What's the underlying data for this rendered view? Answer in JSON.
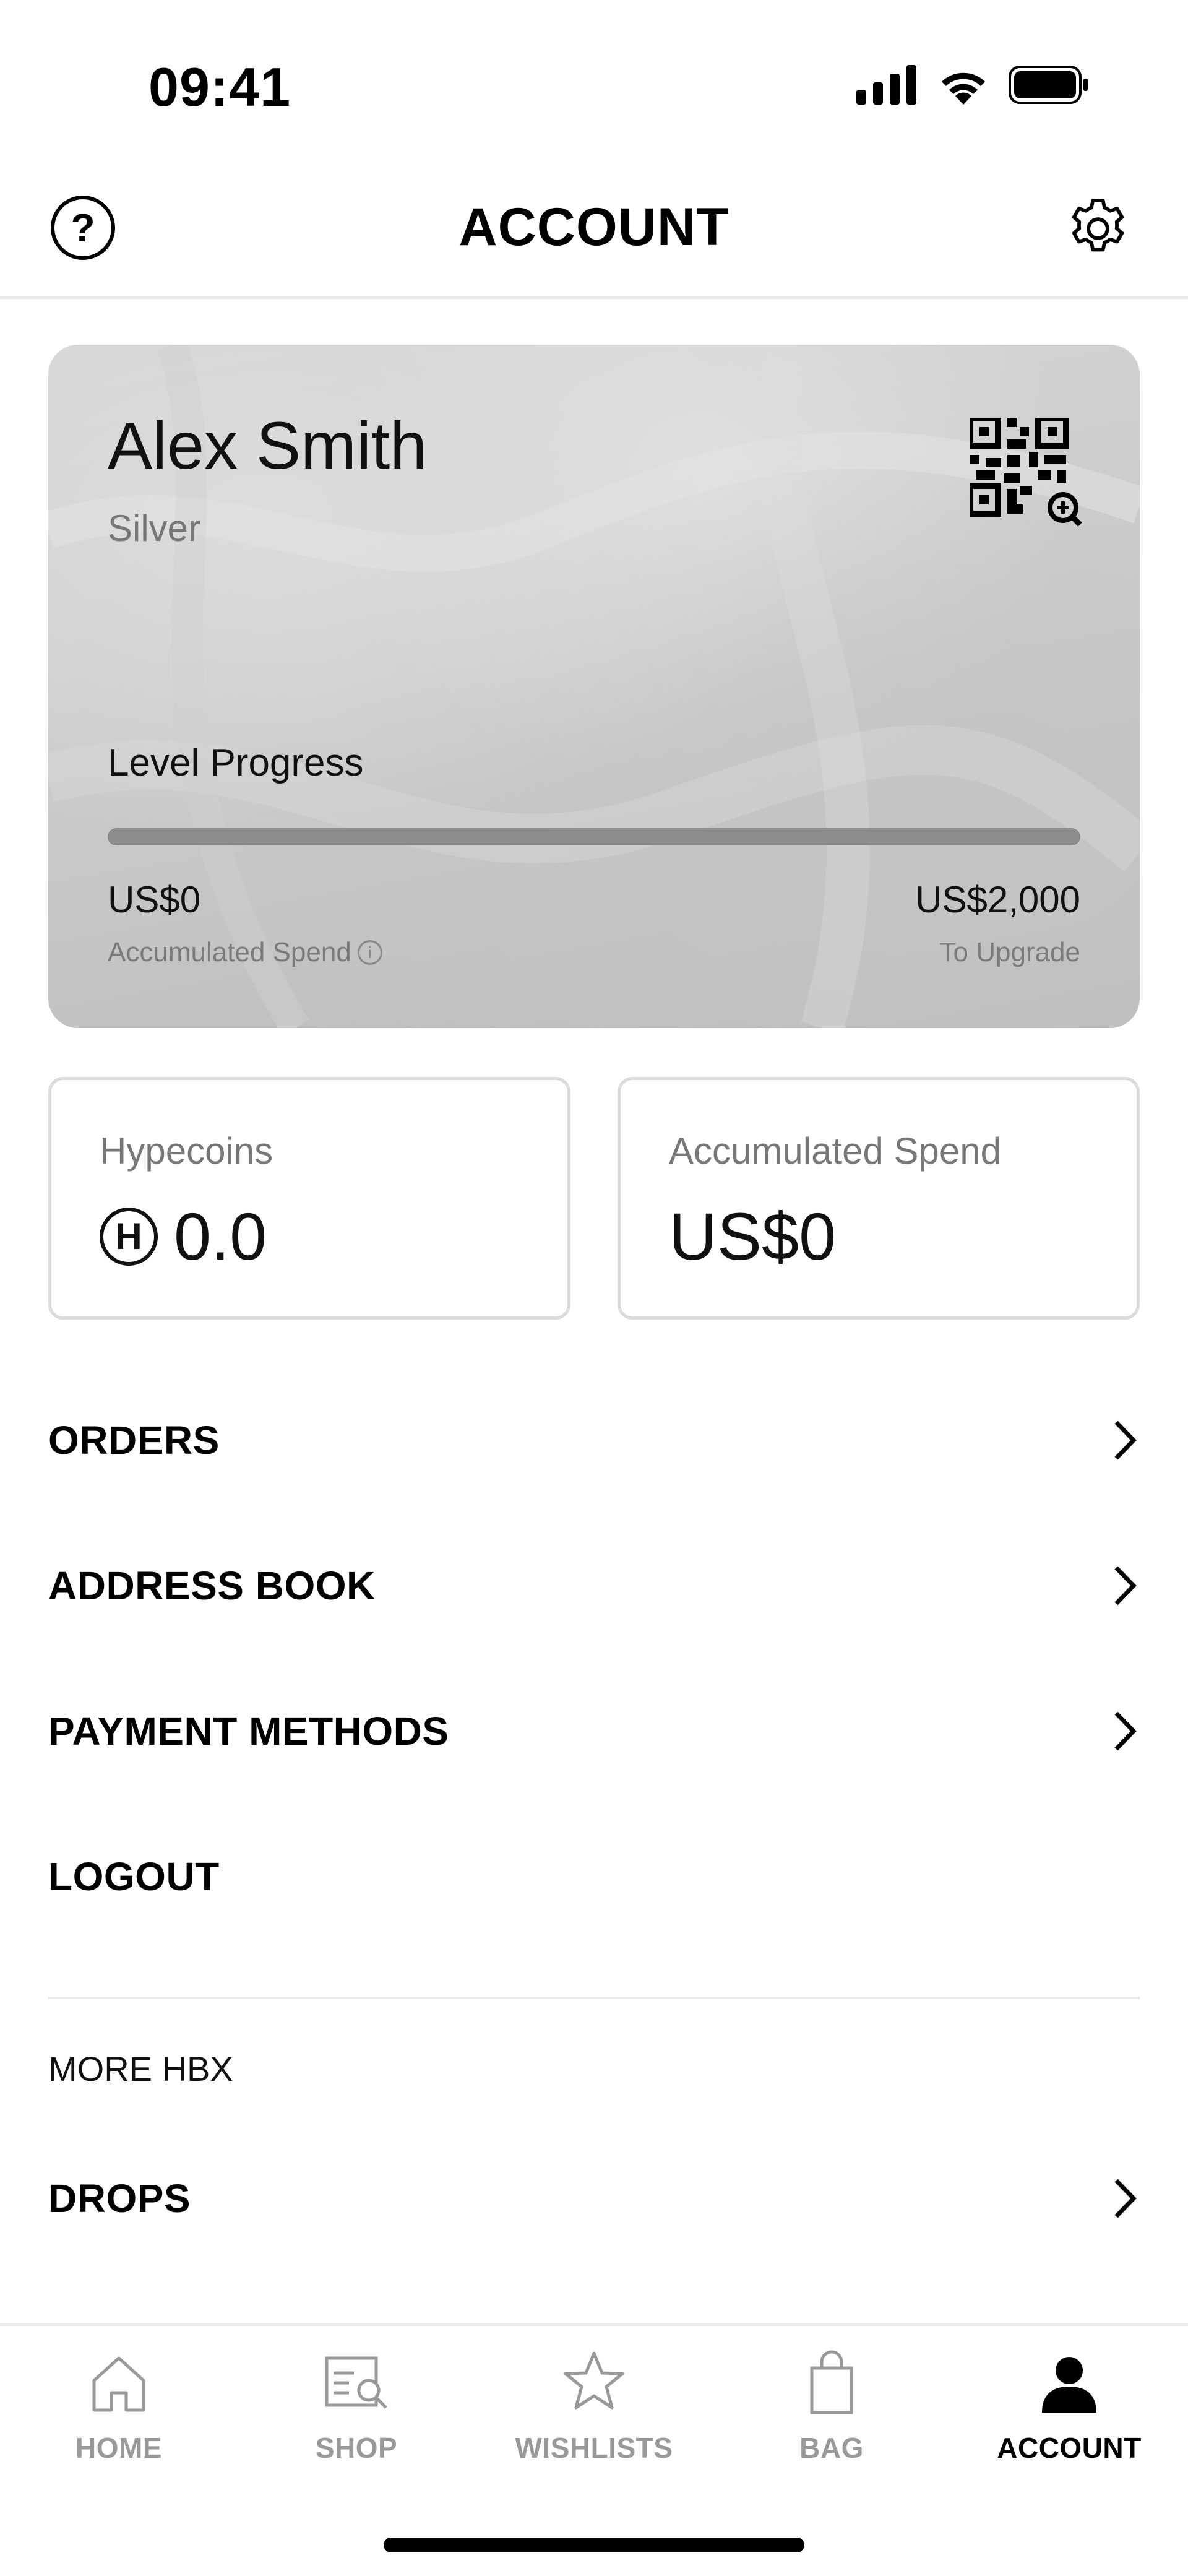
{
  "status_bar": {
    "time": "09:41"
  },
  "header": {
    "title": "ACCOUNT",
    "help_glyph": "?"
  },
  "member_card": {
    "name": "Alex Smith",
    "tier": "Silver",
    "progress_label": "Level Progress",
    "progress_fraction": 0,
    "accumulated_amount": "US$0",
    "accumulated_label": "Accumulated Spend",
    "upgrade_amount": "US$2,000",
    "upgrade_label": "To Upgrade",
    "info_glyph": "i"
  },
  "stats": {
    "hypecoins": {
      "label": "Hypecoins",
      "value": "0.0",
      "coin_glyph": "H"
    },
    "accumulated_spend": {
      "label": "Accumulated Spend",
      "value": "US$0"
    }
  },
  "menu": [
    {
      "label": "ORDERS",
      "has_chevron": true
    },
    {
      "label": "ADDRESS BOOK",
      "has_chevron": true
    },
    {
      "label": "PAYMENT METHODS",
      "has_chevron": true
    },
    {
      "label": "LOGOUT",
      "has_chevron": false
    }
  ],
  "more_section": {
    "title": "MORE HBX",
    "items": [
      {
        "label": "DROPS",
        "has_chevron": true
      }
    ]
  },
  "tab_bar": {
    "items": [
      {
        "label": "HOME",
        "icon": "home-icon",
        "active": false
      },
      {
        "label": "SHOP",
        "icon": "shop-search-icon",
        "active": false
      },
      {
        "label": "WISHLISTS",
        "icon": "star-icon",
        "active": false
      },
      {
        "label": "BAG",
        "icon": "bag-icon",
        "active": false
      },
      {
        "label": "ACCOUNT",
        "icon": "user-icon",
        "active": true
      }
    ]
  },
  "colors": {
    "active": "#000000",
    "inactive": "#999999",
    "card": "#c8c8c8"
  }
}
